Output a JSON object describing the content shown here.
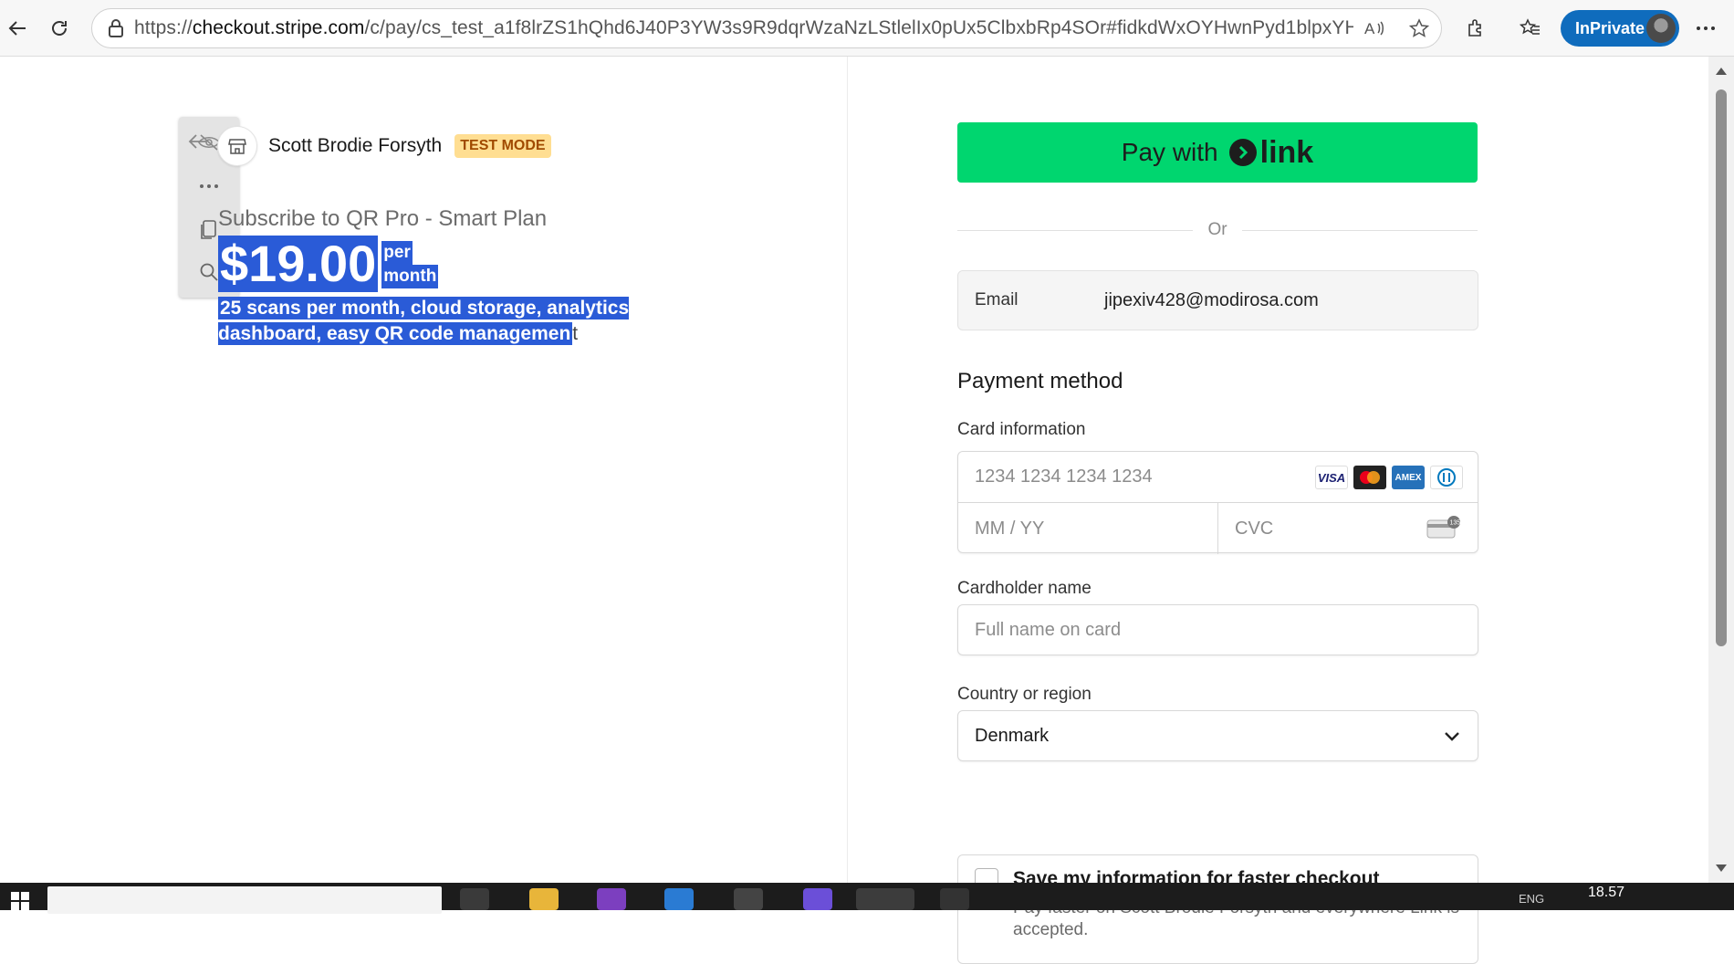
{
  "browser": {
    "url_domain": "checkout.stripe.com",
    "url_rest": "/c/pay/cs_test_a1f8lrZS1hQhd6J40P3YW3s9R9dqrWzaNzLStlelIx0pUx5ClbxbRp4SOr#fidkdWxOYHwnPyd1blpxYHZ...",
    "url_scheme": "https://",
    "inprivate_label": "InPrivate"
  },
  "merchant": {
    "name": "Scott Brodie Forsyth",
    "badge": "TEST MODE"
  },
  "product": {
    "title": "Subscribe to QR Pro - Smart Plan",
    "price": "$19.00",
    "per": "per",
    "period": "month",
    "description_selected": "25 scans per month, cloud storage, analytics dashboard, easy QR code managemen",
    "description_rest": "t"
  },
  "checkout": {
    "pay_button_prefix": "Pay with",
    "pay_button_brand": "link",
    "or": "Or",
    "email_label": "Email",
    "email_value": "jipexiv428@modirosa.com",
    "payment_heading": "Payment method",
    "card_info_label": "Card information",
    "card_number_placeholder": "1234 1234 1234 1234",
    "expiry_placeholder": "MM / YY",
    "cvc_placeholder": "CVC",
    "cardholder_label": "Cardholder name",
    "cardholder_placeholder": "Full name on card",
    "country_label": "Country or region",
    "country_value": "Denmark",
    "save_title": "Save my information for faster checkout",
    "save_desc": "Pay faster on Scott Brodie Forsyth and everywhere Link is accepted."
  },
  "card_brands": [
    "VISA",
    "mastercard",
    "AMEX",
    "diners"
  ],
  "taskbar": {
    "time": "18.57",
    "lang": "ENG"
  },
  "colors": {
    "link_green": "#00d66f",
    "selection_blue": "#2a5bd7",
    "test_badge_bg": "#ffde92",
    "inprivate_blue": "#0f6cbd"
  }
}
